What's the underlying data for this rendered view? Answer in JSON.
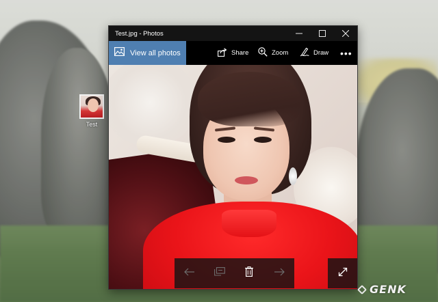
{
  "window": {
    "title": "Test.jpg - Photos",
    "controls": {
      "minimize_icon": "minimize-icon",
      "maximize_icon": "maximize-icon",
      "close_icon": "close-icon"
    }
  },
  "toolbar": {
    "view_all_label": "View all photos",
    "share_label": "Share",
    "zoom_label": "Zoom",
    "draw_label": "Draw",
    "more_label": "•••",
    "accent_color": "#4f7fb1"
  },
  "photo_controls": {
    "previous_icon": "arrow-left-icon",
    "slideshow_icon": "slideshow-icon",
    "delete_icon": "trash-icon",
    "next_icon": "arrow-right-icon",
    "fullscreen_icon": "expand-icon"
  },
  "desktop": {
    "icon_label": "Test"
  },
  "watermark": {
    "text": "GENK"
  }
}
